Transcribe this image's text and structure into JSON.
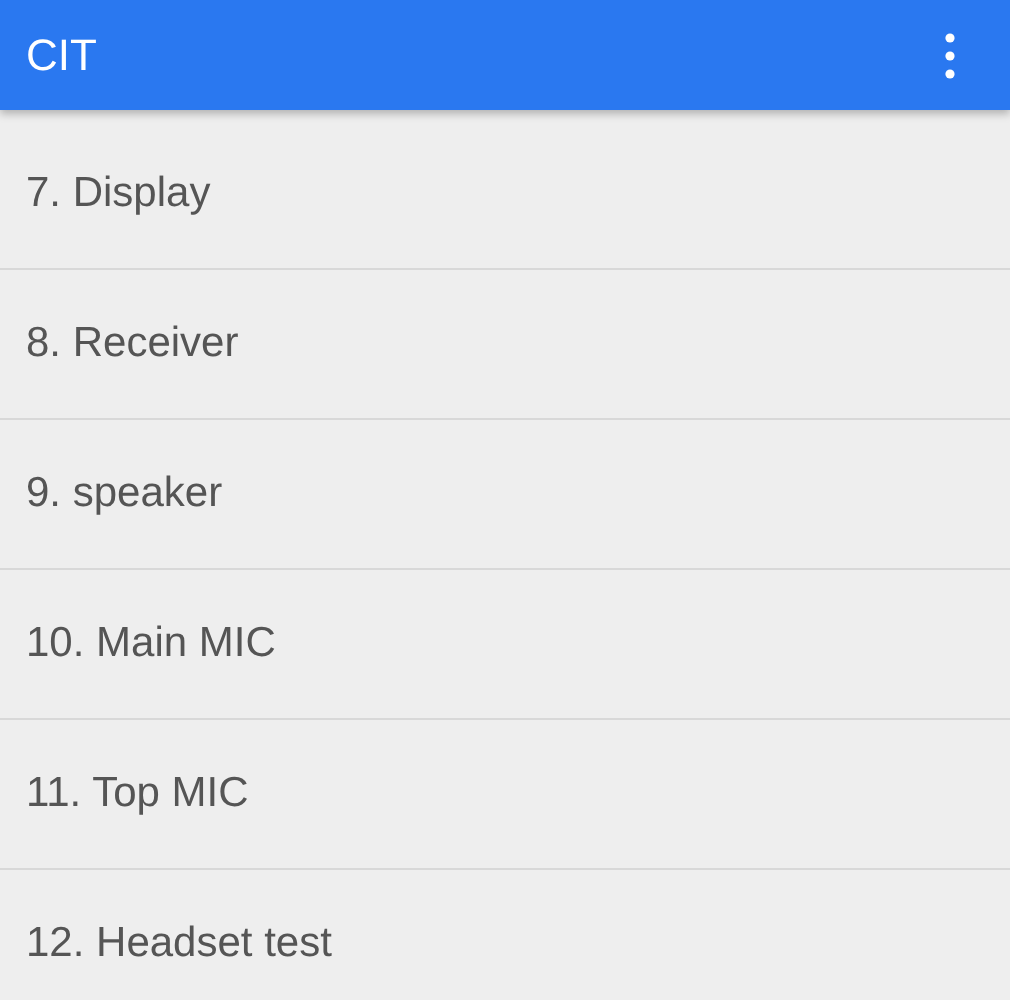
{
  "app_bar": {
    "title": "CIT"
  },
  "items": [
    {
      "label": "7. Display"
    },
    {
      "label": "8. Receiver"
    },
    {
      "label": "9. speaker"
    },
    {
      "label": "10. Main MIC"
    },
    {
      "label": "11. Top MIC"
    },
    {
      "label": "12. Headset test"
    }
  ]
}
